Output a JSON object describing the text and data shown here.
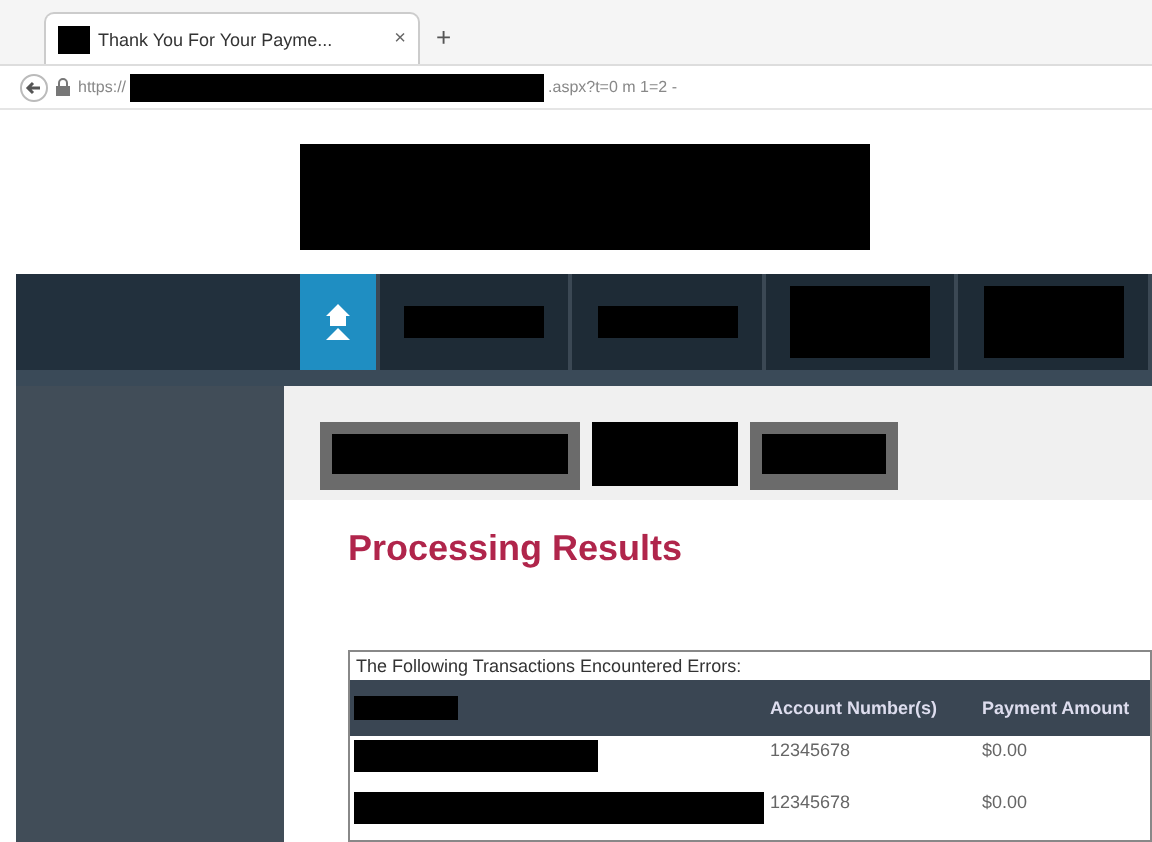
{
  "browser": {
    "tab": {
      "title": "Thank You For Your Payme...",
      "close": "×"
    },
    "new_tab": "+",
    "url": {
      "scheme": "https://",
      "suffix": ".aspx?t=0 m 1=2 -"
    }
  },
  "nav": {
    "items": [
      {
        "kind": "home",
        "selected": true
      },
      {
        "kind": "redacted",
        "selected": false
      },
      {
        "kind": "redacted",
        "selected": false
      },
      {
        "kind": "redacted",
        "selected": false
      },
      {
        "kind": "redacted",
        "selected": false
      }
    ]
  },
  "page": {
    "heading": "Processing Results",
    "table": {
      "caption": "The Following Transactions Encountered Errors:",
      "columns": [
        "Account Number(s)",
        "Payment Amount"
      ],
      "rows": [
        {
          "account": "12345678",
          "amount": "$0.00"
        },
        {
          "account": "12345678",
          "amount": "$0.00"
        }
      ]
    }
  }
}
